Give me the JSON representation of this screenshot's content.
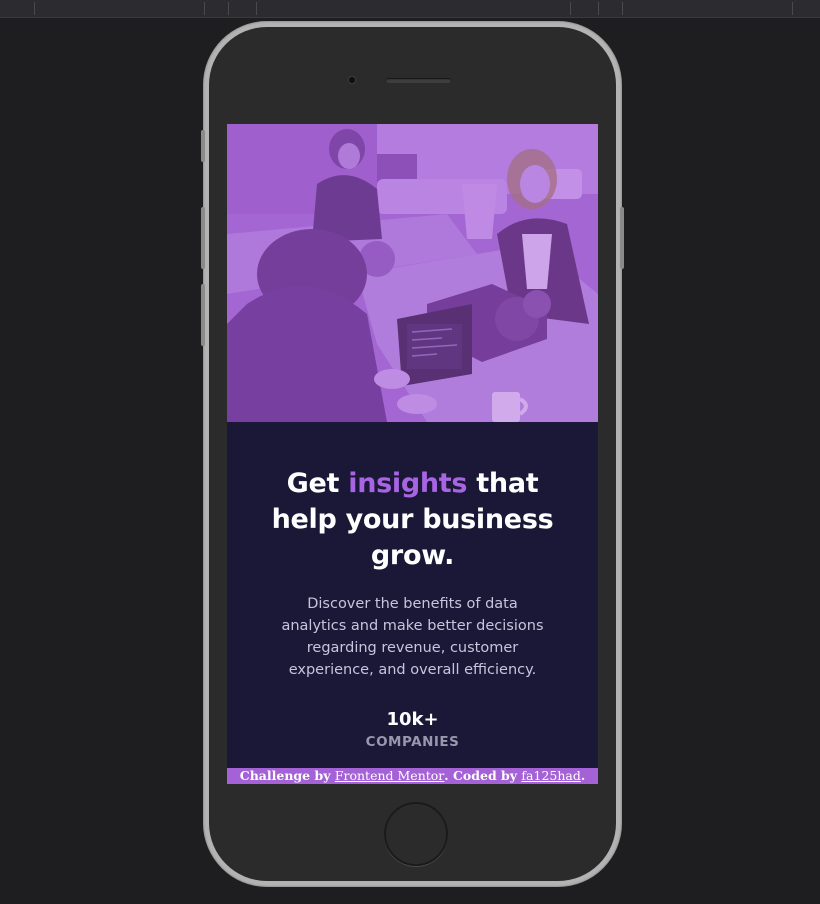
{
  "headline": {
    "part1": "Get ",
    "accent": "insights",
    "part2": " that help your business grow."
  },
  "description": "Discover the benefits of data analytics and make better decisions regarding revenue, customer experience, and overall efficiency.",
  "stats": [
    {
      "value": "10k+",
      "label": "COMPANIES"
    }
  ],
  "attribution": {
    "prefix": "Challenge by ",
    "link1_text": "Frontend Mentor",
    "middle": ". Coded by ",
    "link2_text": "fa125had",
    "suffix": "."
  },
  "colors": {
    "accent": "#a865e3",
    "card_background": "#1b1837",
    "attribution_bar": "#a462d6"
  },
  "icons": {
    "hero_image": "office-team-photo"
  }
}
